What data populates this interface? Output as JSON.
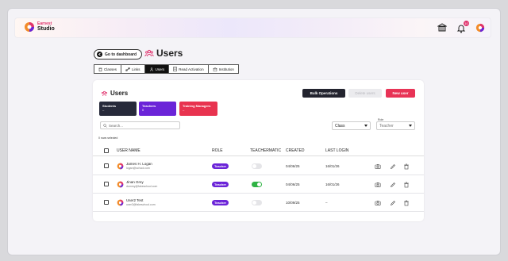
{
  "header": {
    "brand_small": "Earnest",
    "brand_name": "Studio",
    "notification_count": "10"
  },
  "nav": {
    "dashboard_label": "Go to dashboard",
    "page_title": "Users"
  },
  "tabs": [
    {
      "label": "Classes",
      "icon": "trash-icon"
    },
    {
      "label": "Links",
      "icon": "link-icon"
    },
    {
      "label": "Users",
      "icon": "users-icon",
      "active": true
    },
    {
      "label": "Read Activation",
      "icon": "document-icon"
    },
    {
      "label": "Institution",
      "icon": "institution-icon"
    }
  ],
  "card": {
    "title": "Users",
    "bulk_label": "Bulk Operations",
    "delete_label": "Delete users",
    "new_label": "New user"
  },
  "stats": {
    "students_label": "Students",
    "students_value": "–",
    "teachers_label": "Teachers",
    "teachers_value": "0",
    "trainers_label": "Training Managers",
    "trainers_value": "–"
  },
  "filters": {
    "search_placeholder": "Search...",
    "class_value": "Class",
    "role_label": "Role",
    "role_value": "Teacher",
    "selected_count": "0 rows selected"
  },
  "table": {
    "headers": [
      "USER NAME",
      "ROLE",
      "TEACHERMATIC",
      "CREATED",
      "LAST LOGIN"
    ],
    "rows": [
      {
        "name": "James H. Logan",
        "email": "logan@school.com",
        "role": "Teacher",
        "teachermatic": false,
        "created": "04/06/25",
        "last_login": "16/01/26"
      },
      {
        "name": "Jinan Grey",
        "email": "dummy@fakeschool.com",
        "role": "Teacher",
        "teachermatic": true,
        "created": "04/06/25",
        "last_login": "16/01/26"
      },
      {
        "name": "User2 Test",
        "email": "user2@fakeschool.com",
        "role": "Teacher",
        "teachermatic": false,
        "created": "10/09/25",
        "last_login": "–"
      }
    ]
  },
  "colors": {
    "accent_pink": "#e83356",
    "accent_purple": "#6b24d8",
    "dark": "#23242f",
    "toggle_on": "#2fb344"
  }
}
